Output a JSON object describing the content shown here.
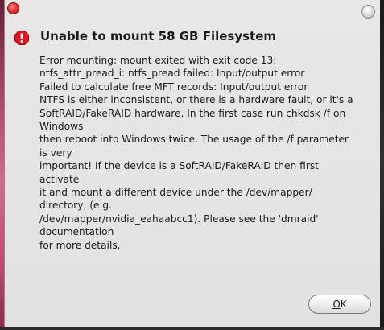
{
  "dialog": {
    "title": "Unable to mount 58 GB Filesystem",
    "icon": "error-icon",
    "lines": [
      "Error mounting: mount exited with exit code 13:",
      "ntfs_attr_pread_i: ntfs_pread failed: Input/output error",
      "Failed to calculate free MFT records: Input/output error",
      "NTFS is either inconsistent, or there is a hardware fault, or it's a",
      "SoftRAID/FakeRAID hardware. In the first case run chkdsk /f on",
      "Windows",
      "then reboot into Windows twice. The usage of the /f parameter",
      "is very",
      "important! If the device is a SoftRAID/FakeRAID then first",
      "activate",
      "it and mount a different device under the /dev/mapper/",
      "directory, (e.g.",
      "/dev/mapper/nvidia_eahaabcc1). Please see the 'dmraid'",
      "documentation",
      "for more details."
    ],
    "ok_mnemonic": "O",
    "ok_rest": "K"
  },
  "colors": {
    "error_red": "#e0141e",
    "close_red": "#e53935",
    "dialog_bg": "#e6e5e4"
  }
}
